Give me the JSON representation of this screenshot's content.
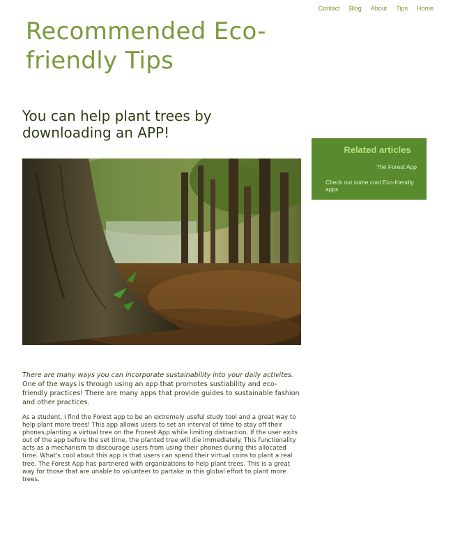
{
  "nav": {
    "items": [
      {
        "label": "Contact"
      },
      {
        "label": "Blog"
      },
      {
        "label": "About"
      },
      {
        "label": "Tips"
      },
      {
        "label": "Home"
      }
    ]
  },
  "site": {
    "title": "Recommended Eco-friendly Tips"
  },
  "article": {
    "heading": "You can help plant trees by downloading an APP!",
    "intro_italic": "There are many ways you can incorporate sustainability into your daily activites.",
    "intro_rest": "One of the ways is through using an app that promotes sustiability and eco-friendly practices! There are many apps that provide guides to sustainable fashion and other practices.",
    "body": "As a student, I find the Forest app to be an extremely useful study tool and a great way to help plant more trees! This app allows users to set an interval of time to stay off their phones,planting a virtual tree on the Frorest App while limiting distraction. If the user exits out of the app before the set time, the planted tree will die immediately. This functionality acts as a mechanism to discourage users from using their phones during this allocated time. What's cool about this app is that users can spend their virtual coins to plant a real tree. The Forest App has partnered with organizations to help plant trees. This is a great way for those that are unable to volunteer to partake in this global effort to plant more trees."
  },
  "hero_image": {
    "icon": "forest-photo"
  },
  "sidebar": {
    "title": "Related articles",
    "links": [
      {
        "label": "The Forest App"
      },
      {
        "label": "Check out some cool Eco-friendly apps"
      }
    ]
  },
  "colors": {
    "accent": "#7a9a3c",
    "sidebar_bg": "#5a8a2e",
    "sidebar_title": "#b8e27a",
    "heading": "#2e3d17"
  }
}
